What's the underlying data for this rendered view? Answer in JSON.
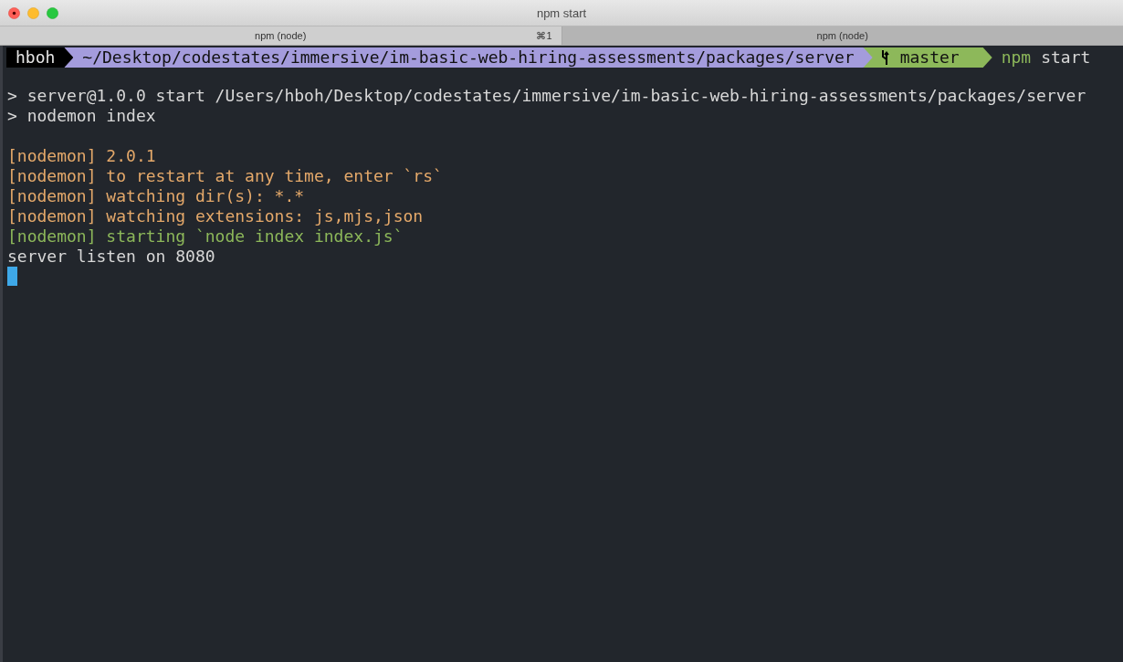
{
  "window": {
    "title": "npm start"
  },
  "tabs": [
    {
      "label": "npm (node)",
      "shortcut": "⌘1",
      "selected": true
    },
    {
      "label": "npm (node)",
      "selected": false
    }
  ],
  "prompt": {
    "user": "hboh",
    "path": "~/Desktop/codestates/immersive/im-basic-web-hiring-assessments/packages/server",
    "branch": "master",
    "command": "npm",
    "argument": "start"
  },
  "output": [
    {
      "kind": "plain",
      "text": "> server@1.0.0 start /Users/hboh/Desktop/codestates/immersive/im-basic-web-hiring-assessments/packages/server"
    },
    {
      "kind": "plain",
      "text": "> nodemon index"
    },
    {
      "kind": "blank"
    },
    {
      "kind": "warn",
      "text": "[nodemon] 2.0.1"
    },
    {
      "kind": "warn",
      "text": "[nodemon] to restart at any time, enter `rs`"
    },
    {
      "kind": "warn",
      "text": "[nodemon] watching dir(s): *.*"
    },
    {
      "kind": "warn",
      "text": "[nodemon] watching extensions: js,mjs,json"
    },
    {
      "kind": "ok",
      "text": "[nodemon] starting `node index index.js`"
    },
    {
      "kind": "plain",
      "text": "server listen on 8080"
    },
    {
      "kind": "cursor"
    }
  ]
}
